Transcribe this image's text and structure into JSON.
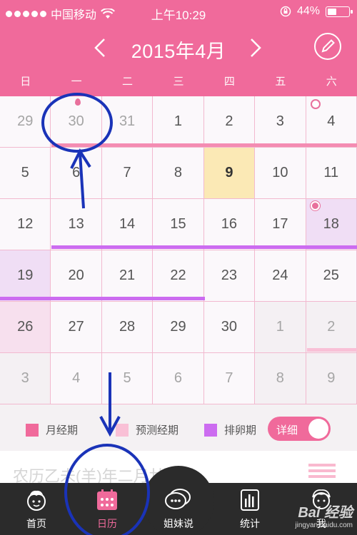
{
  "status": {
    "carrier": "中国移动",
    "time": "上午10:29",
    "battery": "44%",
    "battery_level": 0.44
  },
  "header": {
    "month": "2015年4月"
  },
  "weekdays": [
    "日",
    "一",
    "二",
    "三",
    "四",
    "五",
    "六"
  ],
  "calendar": {
    "rows": [
      [
        "29",
        "30",
        "31",
        "1",
        "2",
        "3",
        "4"
      ],
      [
        "5",
        "6",
        "7",
        "8",
        "9",
        "10",
        "11"
      ],
      [
        "12",
        "13",
        "14",
        "15",
        "16",
        "17",
        "18"
      ],
      [
        "19",
        "20",
        "21",
        "22",
        "23",
        "24",
        "25"
      ],
      [
        "26",
        "27",
        "28",
        "29",
        "30",
        "1",
        "2"
      ],
      [
        "3",
        "4",
        "5",
        "6",
        "7",
        "8",
        "9"
      ]
    ]
  },
  "legend": {
    "period": "月经期",
    "predicted": "预测经期",
    "ovulation": "排卵期",
    "detail_toggle": "详细"
  },
  "colors": {
    "period": "#f06a9b",
    "predicted": "#f9c0d6",
    "ovulation": "#cc6cf0"
  },
  "lunar": {
    "text": "农历乙未(羊)年二月廿"
  },
  "tabs": [
    {
      "label": "首页",
      "icon": "home-face-icon"
    },
    {
      "label": "日历",
      "icon": "calendar-icon"
    },
    {
      "label": "姐妹说",
      "icon": "chat-bubbles-icon"
    },
    {
      "label": "统计",
      "icon": "stats-bars-icon"
    },
    {
      "label": "我",
      "icon": "profile-face-icon"
    }
  ],
  "watermark": {
    "brand": "Bai 经验",
    "url": "jingyan.baidu.com"
  }
}
